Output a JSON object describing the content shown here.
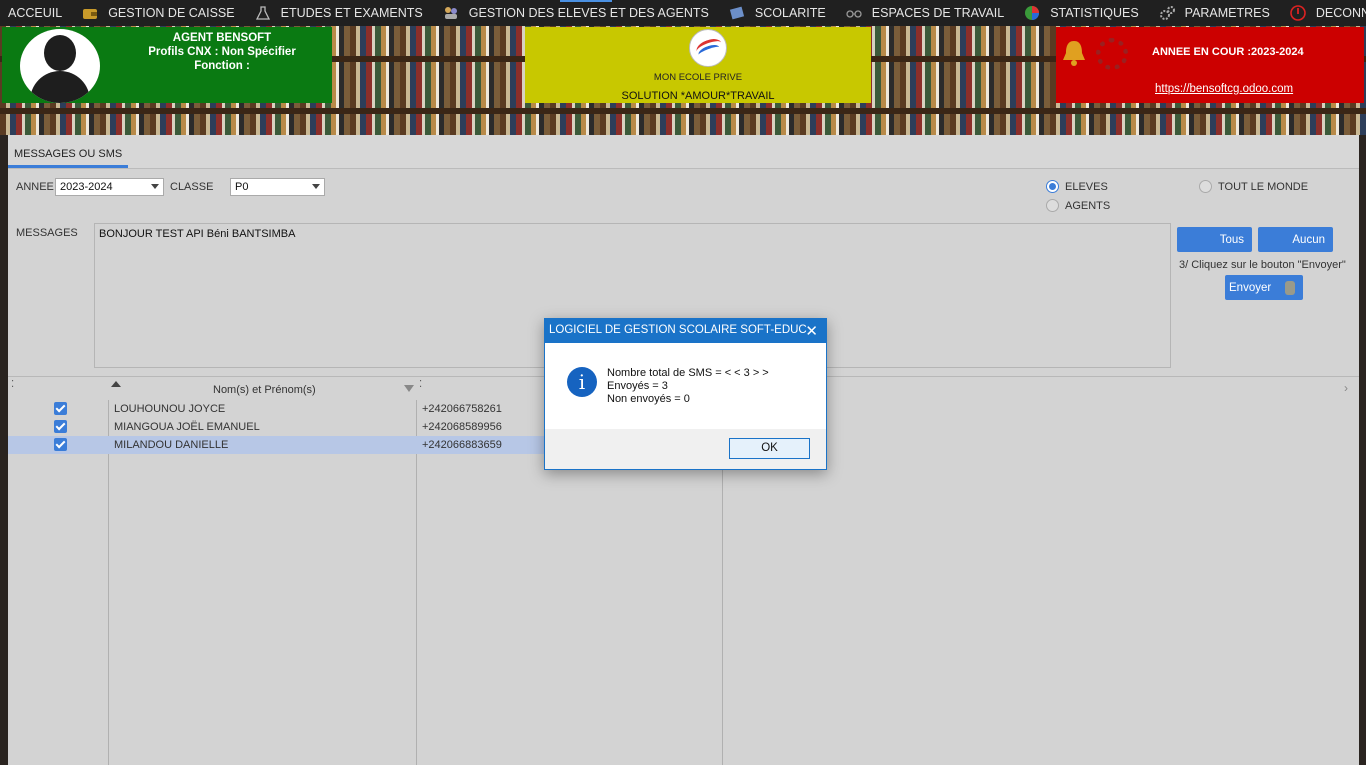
{
  "menu": {
    "items": [
      {
        "label": "ACCEUIL",
        "icon": "home-icon"
      },
      {
        "label": "GESTION DE CAISSE",
        "icon": "wallet-icon"
      },
      {
        "label": "ETUDES ET EXAMENTS",
        "icon": "flask-icon"
      },
      {
        "label": "GESTION DES ELEVES ET DES AGENTS",
        "icon": "people-icon"
      },
      {
        "label": "SCOLARITE",
        "icon": "book-icon"
      },
      {
        "label": "ESPACES DE TRAVAIL",
        "icon": "glasses-icon"
      },
      {
        "label": "STATISTIQUES",
        "icon": "pie-chart-icon"
      },
      {
        "label": "PARAMETRES",
        "icon": "gear-icon"
      },
      {
        "label": "DECONNEXION",
        "icon": "power-icon"
      }
    ]
  },
  "header": {
    "agent_name": "AGENT BENSOFT",
    "profil": "Profils CNX : Non Spécifier",
    "fonction": "Fonction :",
    "school_name": "MON ECOLE PRIVE",
    "motto": "SOLUTION *AMOUR*TRAVAIL",
    "annee": "ANNEE EN COUR :2023-2024",
    "site": "https://bensoftcg.odoo.com"
  },
  "tab": {
    "label": "MESSAGES OU SMS"
  },
  "form": {
    "annee_label": "ANNEE",
    "annee_value": "2023-2024",
    "classe_label": "CLASSE",
    "classe_value": "P0",
    "messages_label": "MESSAGES",
    "message_text": "BONJOUR TEST API Béni BANTSIMBA",
    "radio_eleves": "ELEVES",
    "radio_agents": "AGENTS",
    "radio_tout": "TOUT LE MONDE",
    "btn_tous": "Tous",
    "btn_aucun": "Aucun",
    "hint": "3/ Cliquez sur le bouton \"Envoyer\"",
    "btn_envoyer": "Envoyer"
  },
  "grid": {
    "col_name": "Nom(s) et Prénom(s)",
    "rows": [
      {
        "name": "LOUHOUNOU JOYCE",
        "phone": "+242066758261",
        "checked": true
      },
      {
        "name": "MIANGOUA JOËL EMANUEL",
        "phone": "+242068589956",
        "checked": true
      },
      {
        "name": "MILANDOU  DANIELLE",
        "phone": "+242066883659",
        "checked": true
      }
    ]
  },
  "dialog": {
    "title": "LOGICIEL DE GESTION SCOLAIRE SOFT-EDUC",
    "line1": "Nombre total de SMS =  < < 3 > >",
    "line2": "Envoyés = 3",
    "line3": "Non envoyés = 0",
    "ok": "OK"
  }
}
